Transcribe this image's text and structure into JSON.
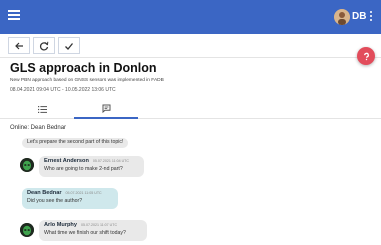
{
  "appbar": {
    "user_initials": "DB",
    "accent_color": "#3b66c4"
  },
  "toolbar": {
    "buttons": [
      "back-arrow-icon",
      "refresh-icon",
      "check-icon"
    ]
  },
  "fab": {
    "icon": "question-icon",
    "color": "#e24c5b"
  },
  "topic": {
    "title": "GLS approach in Donlon",
    "subtitle": "New PBN approach based on GNSS sensors was implemented in FADB",
    "dates": "08.04.2021 09:04 UTC - 10.05.2022 13:06 UTC"
  },
  "tabs": [
    {
      "icon": "list-icon",
      "active": false
    },
    {
      "icon": "chat-icon",
      "active": true
    }
  ],
  "chat": {
    "online_label": "Online: Dean Bednar",
    "messages": [
      {
        "author": "",
        "time": "",
        "text": "Let's prepare the second part of this topic!",
        "mine": false,
        "partial": true
      },
      {
        "author": "Ernest Anderson",
        "time": "05.07.2021 11:04 UTC",
        "text": "Who are going to make 2-nd part?",
        "mine": false
      },
      {
        "author": "Dean Bednar",
        "time": "05.07.2021 11:05 UTC",
        "text": "Did you see the author?",
        "mine": true
      },
      {
        "author": "Arlo Murphy",
        "time": "05.07.2021 11:07 UTC",
        "text": "What time we finish our shift today?",
        "mine": false
      }
    ]
  }
}
